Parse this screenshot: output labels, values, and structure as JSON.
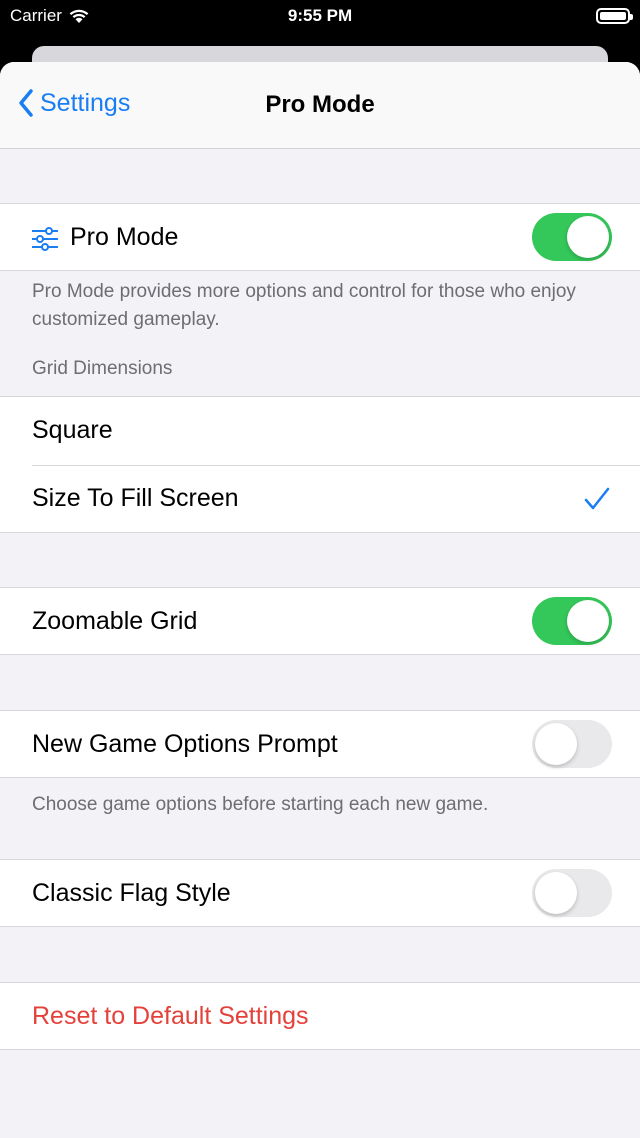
{
  "status_bar": {
    "carrier": "Carrier",
    "time": "9:55 PM"
  },
  "nav": {
    "back_label": "Settings",
    "title": "Pro Mode"
  },
  "pro_mode": {
    "label": "Pro Mode",
    "enabled": true,
    "footnote": "Pro Mode provides more options and control for those who enjoy customized gameplay."
  },
  "grid": {
    "header": "Grid Dimensions",
    "options": [
      {
        "label": "Square",
        "selected": false
      },
      {
        "label": "Size To Fill Screen",
        "selected": true
      }
    ]
  },
  "zoomable": {
    "label": "Zoomable Grid",
    "enabled": true
  },
  "new_game": {
    "label": "New Game Options Prompt",
    "enabled": false,
    "footnote": "Choose game options before starting each new game."
  },
  "classic_flag": {
    "label": "Classic Flag Style",
    "enabled": false
  },
  "reset": {
    "label": "Reset to Default Settings",
    "color": "#e5413b"
  },
  "colors": {
    "accent": "#1a7ef2",
    "toggle_on": "#34c759",
    "toggle_off": "#e9e9eb"
  }
}
